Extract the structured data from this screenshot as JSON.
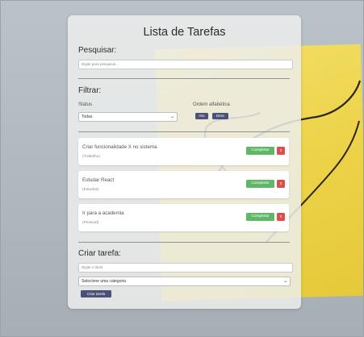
{
  "app": {
    "title": "Lista de Tarefas"
  },
  "search": {
    "heading": "Pesquisar:",
    "placeholder": "Digite para pesquisar..."
  },
  "filter": {
    "heading": "Filtrar:",
    "status_label": "Status",
    "status_selected": "Todas",
    "order_label": "Ordem alfabética",
    "asc_label": "Asc",
    "desc_label": "Desc"
  },
  "tasks": [
    {
      "title": "Criar funcionalidade X no sistema",
      "category": "(Trabalho)",
      "complete_label": "Completar",
      "delete_label": "x"
    },
    {
      "title": "Estudar React",
      "category": "(Estudos)",
      "complete_label": "Completar",
      "delete_label": "x"
    },
    {
      "title": "Ir para a academia",
      "category": "(Pessoal)",
      "complete_label": "Completar",
      "delete_label": "x"
    }
  ],
  "create": {
    "heading": "Criar tarefa:",
    "title_placeholder": "Digite o título",
    "category_placeholder": "Selecione uma categoria",
    "submit_label": "Criar tarefa"
  },
  "colors": {
    "complete": "#5fb868",
    "delete": "#e04b4b",
    "primary_button": "#4a5279",
    "sticky_note": "#ecd247"
  }
}
